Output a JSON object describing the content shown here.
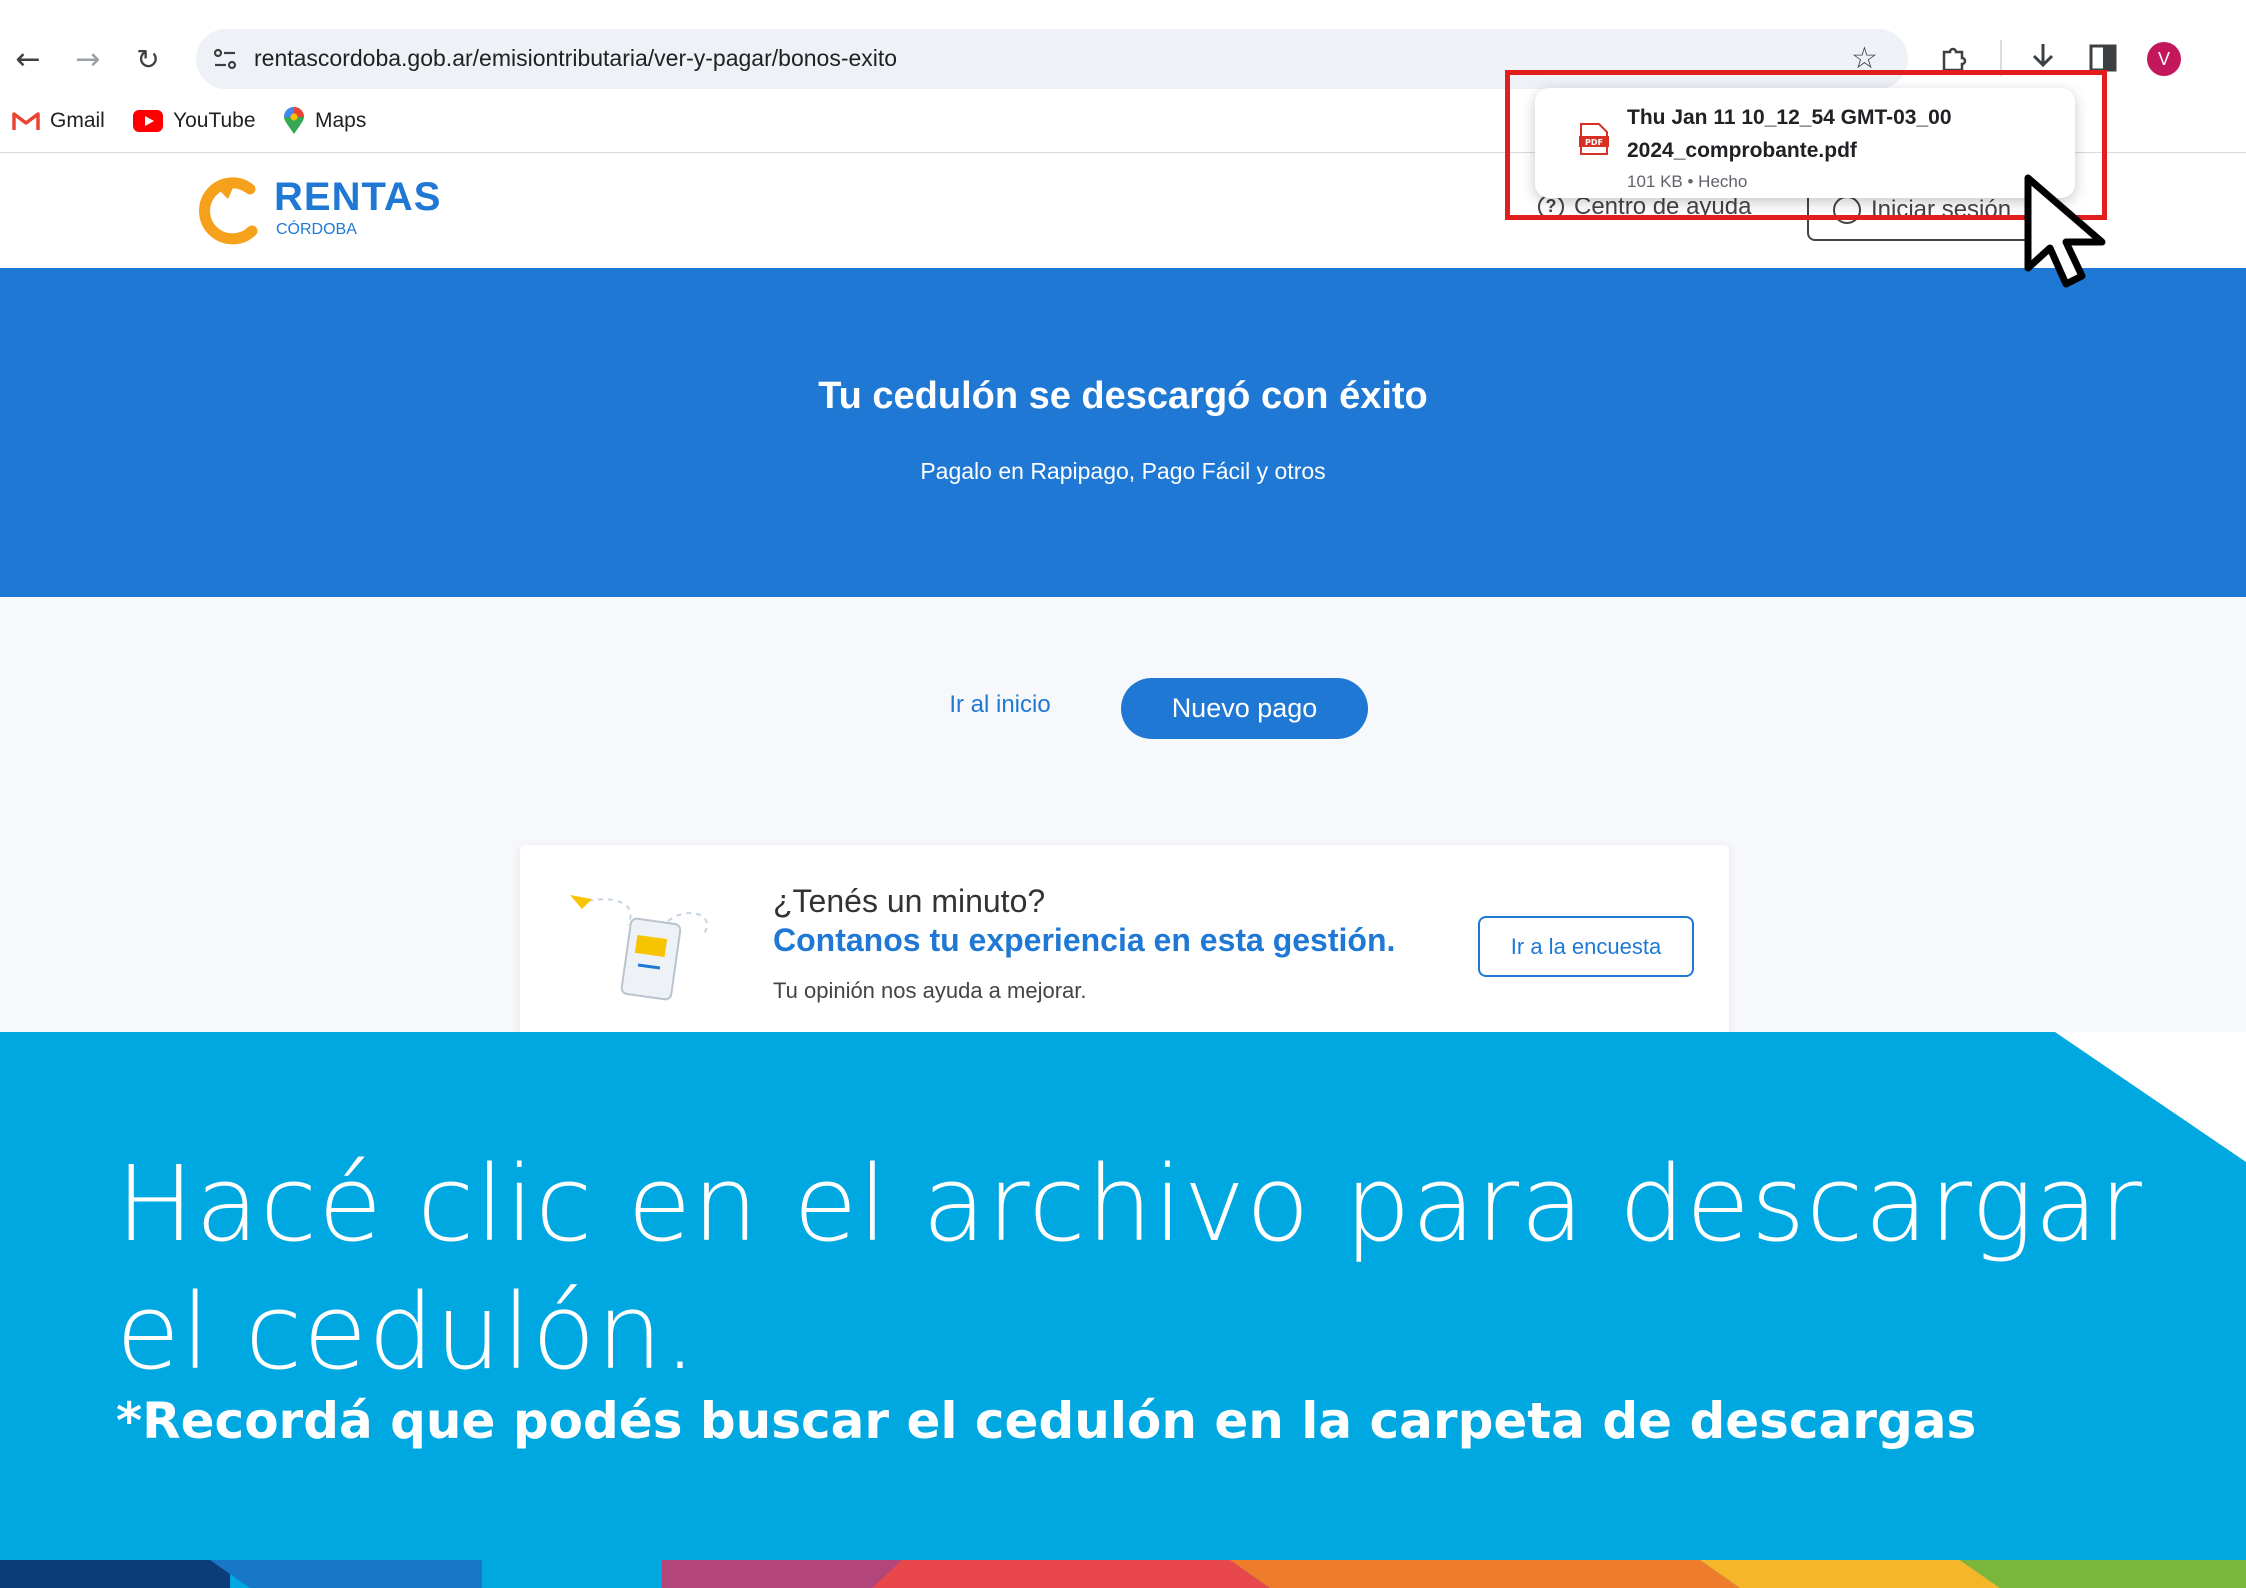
{
  "browser": {
    "url": "rentascordoba.gob.ar/emisiontributaria/ver-y-pagar/bonos-exito",
    "profile_initial": "V",
    "bookmarks": [
      {
        "label": "Gmail",
        "icon": "gmail-icon"
      },
      {
        "label": "YouTube",
        "icon": "youtube-icon"
      },
      {
        "label": "Maps",
        "icon": "maps-icon"
      }
    ]
  },
  "download": {
    "filename_line1": "Thu Jan 11 10_12_54 GMT-03_00",
    "filename_line2": "2024_comprobante.pdf",
    "meta": "101 KB • Hecho",
    "file_icon_label": "PDF"
  },
  "site": {
    "logo_main": "RENTAS",
    "logo_sub": "CÓRDOBA",
    "help_label": "Centro de ayuda",
    "login_label": "Iniciar sesión"
  },
  "hero": {
    "title": "Tu cedulón se descargó con éxito",
    "subtitle": "Pagalo en Rapipago, Pago Fácil y otros"
  },
  "actions": {
    "home_label": "Ir al inicio",
    "new_payment_label": "Nuevo pago"
  },
  "survey": {
    "question": "¿Tenés un minuto?",
    "headline": "Contanos tu experiencia en esta gestión.",
    "note": "Tu opinión nos ayuda a mejorar.",
    "button_label": "Ir a la encuesta"
  },
  "overlay": {
    "title": "Hacé clic en el archivo para descargar el cedulón.",
    "note": "*Recordá que podés buscar el cedulón en la carpeta de descargas"
  },
  "colors": {
    "hero_blue": "#1f79d4",
    "overlay_blue": "#00a8e2",
    "highlight_red": "#e21d1d",
    "logo_orange": "#f5a11c"
  }
}
